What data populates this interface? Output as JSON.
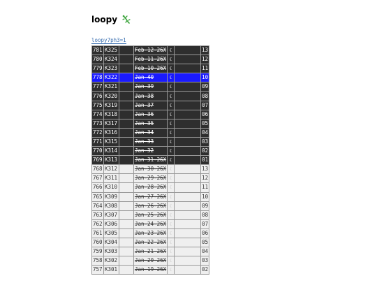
{
  "header": {
    "title": "loopy",
    "logo_icon": "gecko-icon",
    "logo_color": "#3aa33a"
  },
  "tab": {
    "label": "loopy7ph3=1"
  },
  "colors": {
    "dark_row": "#2e2e2e",
    "selected_row": "#1a1aff",
    "light_row": "#efefef"
  },
  "rows": [
    {
      "id": "781",
      "k": "K325",
      "date": "Feb-12-26X",
      "icon": "moon-icon",
      "num": "13",
      "style": "dark"
    },
    {
      "id": "780",
      "k": "K324",
      "date": "Feb-11-26X",
      "icon": "moon-icon",
      "num": "12",
      "style": "dark"
    },
    {
      "id": "779",
      "k": "K323",
      "date": "Feb-10-26X",
      "icon": "moon-icon",
      "num": "11",
      "style": "dark"
    },
    {
      "id": "778",
      "k": "K322",
      "date": "Jan-40",
      "icon": "moon-icon",
      "num": "10",
      "style": "sel"
    },
    {
      "id": "777",
      "k": "K321",
      "date": "Jan-39",
      "icon": "moon-icon",
      "num": "09",
      "style": "dark"
    },
    {
      "id": "776",
      "k": "K320",
      "date": "Jan-38",
      "icon": "moon-icon",
      "num": "08",
      "style": "dark"
    },
    {
      "id": "775",
      "k": "K319",
      "date": "Jan-37",
      "icon": "moon-icon",
      "num": "07",
      "style": "dark"
    },
    {
      "id": "774",
      "k": "K318",
      "date": "Jan-36",
      "icon": "moon-icon",
      "num": "06",
      "style": "dark"
    },
    {
      "id": "773",
      "k": "K317",
      "date": "Jan-35",
      "icon": "moon-icon",
      "num": "05",
      "style": "dark"
    },
    {
      "id": "772",
      "k": "K316",
      "date": "Jan-34",
      "icon": "moon-icon",
      "num": "04",
      "style": "dark"
    },
    {
      "id": "771",
      "k": "K315",
      "date": "Jan-33",
      "icon": "moon-icon",
      "num": "03",
      "style": "dark"
    },
    {
      "id": "770",
      "k": "K314",
      "date": "Jan-32",
      "icon": "moon-icon",
      "num": "02",
      "style": "dark"
    },
    {
      "id": "769",
      "k": "K313",
      "date": "Jan-31-26X",
      "icon": "moon-icon",
      "num": "01",
      "style": "dark"
    },
    {
      "id": "768",
      "k": "K312",
      "date": "Jan-30-26X",
      "icon": "moon-icon",
      "num": "13",
      "style": "light"
    },
    {
      "id": "767",
      "k": "K311",
      "date": "Jan-29-26X",
      "icon": "moon-icon",
      "num": "12",
      "style": "light"
    },
    {
      "id": "766",
      "k": "K310",
      "date": "Jan-28-26X",
      "icon": "moon-icon",
      "num": "11",
      "style": "light"
    },
    {
      "id": "765",
      "k": "K309",
      "date": "Jan-27-26X",
      "icon": "moon-icon",
      "num": "10",
      "style": "light"
    },
    {
      "id": "764",
      "k": "K308",
      "date": "Jan-26-26X",
      "icon": "moon-icon",
      "num": "09",
      "style": "light"
    },
    {
      "id": "763",
      "k": "K307",
      "date": "Jan-25-26X",
      "icon": "moon-icon",
      "num": "08",
      "style": "light"
    },
    {
      "id": "762",
      "k": "K306",
      "date": "Jan-24-26X",
      "icon": "moon-icon",
      "num": "07",
      "style": "light"
    },
    {
      "id": "761",
      "k": "K305",
      "date": "Jan-23-26X",
      "icon": "moon-icon",
      "num": "06",
      "style": "light"
    },
    {
      "id": "760",
      "k": "K304",
      "date": "Jan-22-26X",
      "icon": "moon-icon",
      "num": "05",
      "style": "light"
    },
    {
      "id": "759",
      "k": "K303",
      "date": "Jan-21-26X",
      "icon": "moon-icon",
      "num": "04",
      "style": "light"
    },
    {
      "id": "758",
      "k": "K302",
      "date": "Jan-20-26X",
      "icon": "moon-icon",
      "num": "03",
      "style": "light"
    },
    {
      "id": "757",
      "k": "K301",
      "date": "Jan-19-26X",
      "icon": "moon-icon",
      "num": "02",
      "style": "light"
    }
  ]
}
